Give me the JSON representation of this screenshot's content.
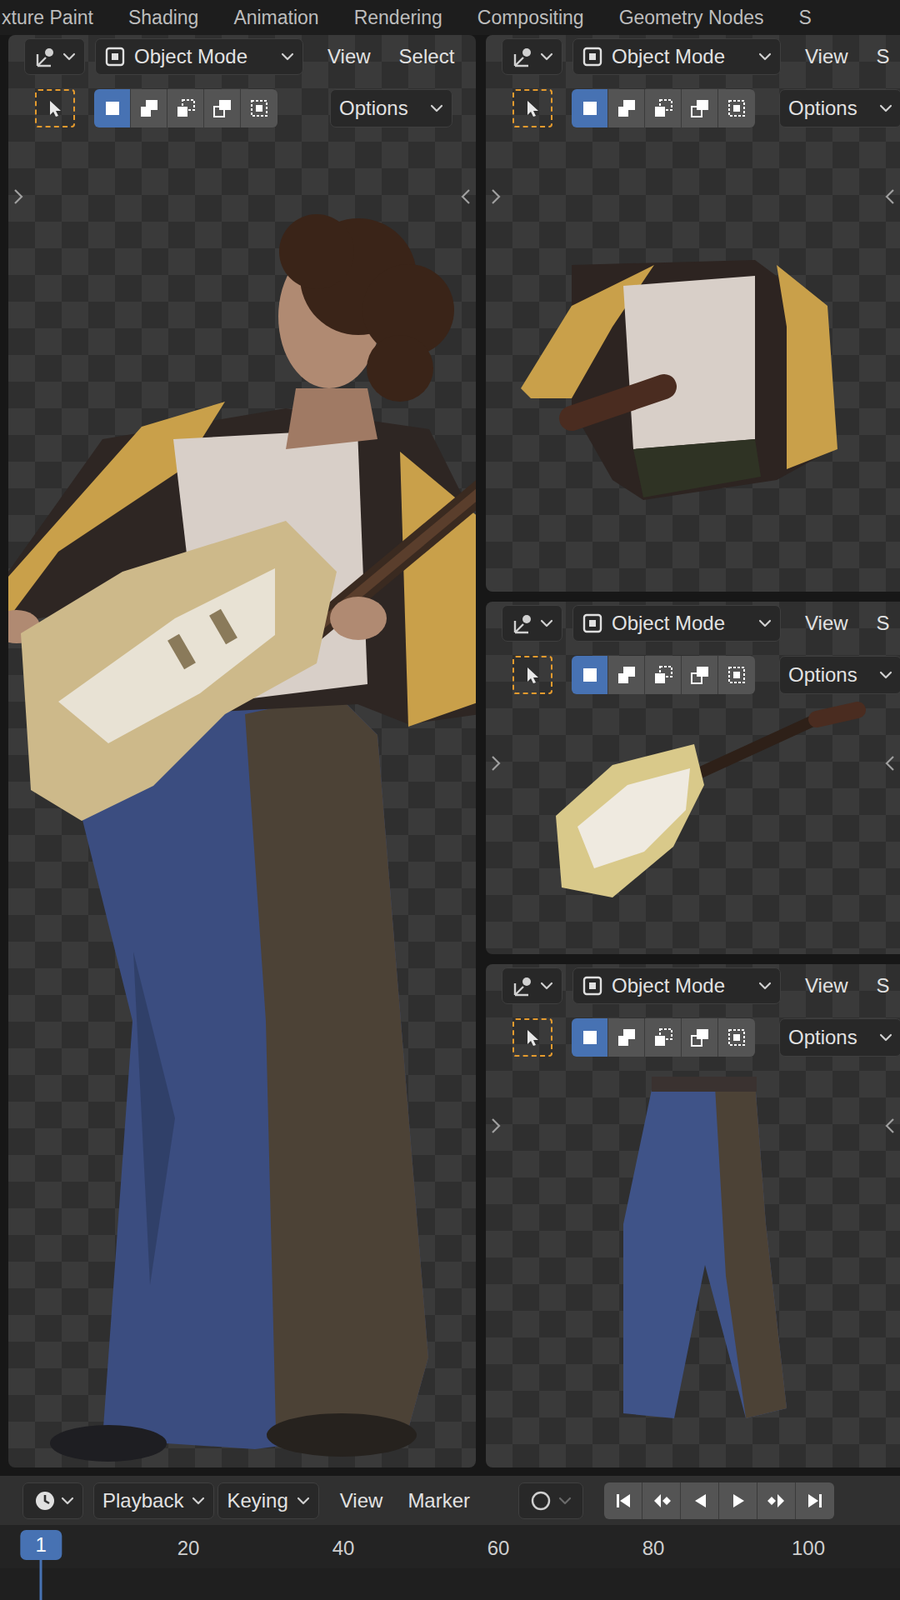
{
  "workspace_tabs": [
    {
      "label": "xture Paint",
      "selected": false
    },
    {
      "label": "Shading",
      "selected": false
    },
    {
      "label": "Animation",
      "selected": false
    },
    {
      "label": "Rendering",
      "selected": false
    },
    {
      "label": "Compositing",
      "selected": false
    },
    {
      "label": "Geometry Nodes",
      "selected": false
    },
    {
      "label": "S",
      "selected": false
    }
  ],
  "viewports": [
    {
      "kind": "character",
      "mode": "Object Mode",
      "menus": [
        "View",
        "Select"
      ],
      "options": "Options",
      "select_modes": [
        {
          "selected": true
        },
        {
          "selected": false
        },
        {
          "selected": false
        },
        {
          "selected": false
        },
        {
          "selected": false
        }
      ]
    },
    {
      "kind": "jacket",
      "mode": "Object Mode",
      "menus": [
        "View",
        "S"
      ],
      "options": "Options",
      "select_modes": [
        {
          "selected": true
        },
        {
          "selected": false
        },
        {
          "selected": false
        },
        {
          "selected": false
        },
        {
          "selected": false
        }
      ]
    },
    {
      "kind": "guitar",
      "mode": "Object Mode",
      "menus": [
        "View",
        "S"
      ],
      "options": "Options",
      "select_modes": [
        {
          "selected": true
        },
        {
          "selected": false
        },
        {
          "selected": false
        },
        {
          "selected": false
        },
        {
          "selected": false
        }
      ]
    },
    {
      "kind": "pants",
      "mode": "Object Mode",
      "menus": [
        "View",
        "S"
      ],
      "options": "Options",
      "select_modes": [
        {
          "selected": true
        },
        {
          "selected": false
        },
        {
          "selected": false
        },
        {
          "selected": false
        },
        {
          "selected": false
        }
      ]
    }
  ],
  "timeline": {
    "menus": [
      {
        "label": "Playback",
        "dropdown": true
      },
      {
        "label": "Keying",
        "dropdown": true
      },
      {
        "label": "View",
        "dropdown": false
      },
      {
        "label": "Marker",
        "dropdown": false
      }
    ],
    "auto_keying": false,
    "current_frame": "1",
    "ruler": [
      "20",
      "40",
      "60",
      "80",
      "100"
    ]
  }
}
